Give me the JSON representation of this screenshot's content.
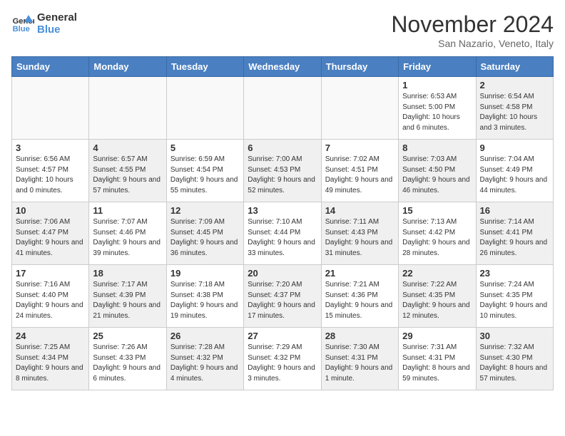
{
  "logo": {
    "line1": "General",
    "line2": "Blue"
  },
  "title": "November 2024",
  "location": "San Nazario, Veneto, Italy",
  "days_of_week": [
    "Sunday",
    "Monday",
    "Tuesday",
    "Wednesday",
    "Thursday",
    "Friday",
    "Saturday"
  ],
  "weeks": [
    [
      {
        "day": "",
        "info": "",
        "empty": true
      },
      {
        "day": "",
        "info": "",
        "empty": true
      },
      {
        "day": "",
        "info": "",
        "empty": true
      },
      {
        "day": "",
        "info": "",
        "empty": true
      },
      {
        "day": "",
        "info": "",
        "empty": true
      },
      {
        "day": "1",
        "info": "Sunrise: 6:53 AM\nSunset: 5:00 PM\nDaylight: 10 hours and 6 minutes."
      },
      {
        "day": "2",
        "info": "Sunrise: 6:54 AM\nSunset: 4:58 PM\nDaylight: 10 hours and 3 minutes.",
        "shaded": true
      }
    ],
    [
      {
        "day": "3",
        "info": "Sunrise: 6:56 AM\nSunset: 4:57 PM\nDaylight: 10 hours and 0 minutes."
      },
      {
        "day": "4",
        "info": "Sunrise: 6:57 AM\nSunset: 4:55 PM\nDaylight: 9 hours and 57 minutes.",
        "shaded": true
      },
      {
        "day": "5",
        "info": "Sunrise: 6:59 AM\nSunset: 4:54 PM\nDaylight: 9 hours and 55 minutes."
      },
      {
        "day": "6",
        "info": "Sunrise: 7:00 AM\nSunset: 4:53 PM\nDaylight: 9 hours and 52 minutes.",
        "shaded": true
      },
      {
        "day": "7",
        "info": "Sunrise: 7:02 AM\nSunset: 4:51 PM\nDaylight: 9 hours and 49 minutes."
      },
      {
        "day": "8",
        "info": "Sunrise: 7:03 AM\nSunset: 4:50 PM\nDaylight: 9 hours and 46 minutes.",
        "shaded": true
      },
      {
        "day": "9",
        "info": "Sunrise: 7:04 AM\nSunset: 4:49 PM\nDaylight: 9 hours and 44 minutes."
      }
    ],
    [
      {
        "day": "10",
        "info": "Sunrise: 7:06 AM\nSunset: 4:47 PM\nDaylight: 9 hours and 41 minutes.",
        "shaded": true
      },
      {
        "day": "11",
        "info": "Sunrise: 7:07 AM\nSunset: 4:46 PM\nDaylight: 9 hours and 39 minutes."
      },
      {
        "day": "12",
        "info": "Sunrise: 7:09 AM\nSunset: 4:45 PM\nDaylight: 9 hours and 36 minutes.",
        "shaded": true
      },
      {
        "day": "13",
        "info": "Sunrise: 7:10 AM\nSunset: 4:44 PM\nDaylight: 9 hours and 33 minutes."
      },
      {
        "day": "14",
        "info": "Sunrise: 7:11 AM\nSunset: 4:43 PM\nDaylight: 9 hours and 31 minutes.",
        "shaded": true
      },
      {
        "day": "15",
        "info": "Sunrise: 7:13 AM\nSunset: 4:42 PM\nDaylight: 9 hours and 28 minutes."
      },
      {
        "day": "16",
        "info": "Sunrise: 7:14 AM\nSunset: 4:41 PM\nDaylight: 9 hours and 26 minutes.",
        "shaded": true
      }
    ],
    [
      {
        "day": "17",
        "info": "Sunrise: 7:16 AM\nSunset: 4:40 PM\nDaylight: 9 hours and 24 minutes."
      },
      {
        "day": "18",
        "info": "Sunrise: 7:17 AM\nSunset: 4:39 PM\nDaylight: 9 hours and 21 minutes.",
        "shaded": true
      },
      {
        "day": "19",
        "info": "Sunrise: 7:18 AM\nSunset: 4:38 PM\nDaylight: 9 hours and 19 minutes."
      },
      {
        "day": "20",
        "info": "Sunrise: 7:20 AM\nSunset: 4:37 PM\nDaylight: 9 hours and 17 minutes.",
        "shaded": true
      },
      {
        "day": "21",
        "info": "Sunrise: 7:21 AM\nSunset: 4:36 PM\nDaylight: 9 hours and 15 minutes."
      },
      {
        "day": "22",
        "info": "Sunrise: 7:22 AM\nSunset: 4:35 PM\nDaylight: 9 hours and 12 minutes.",
        "shaded": true
      },
      {
        "day": "23",
        "info": "Sunrise: 7:24 AM\nSunset: 4:35 PM\nDaylight: 9 hours and 10 minutes."
      }
    ],
    [
      {
        "day": "24",
        "info": "Sunrise: 7:25 AM\nSunset: 4:34 PM\nDaylight: 9 hours and 8 minutes.",
        "shaded": true
      },
      {
        "day": "25",
        "info": "Sunrise: 7:26 AM\nSunset: 4:33 PM\nDaylight: 9 hours and 6 minutes."
      },
      {
        "day": "26",
        "info": "Sunrise: 7:28 AM\nSunset: 4:32 PM\nDaylight: 9 hours and 4 minutes.",
        "shaded": true
      },
      {
        "day": "27",
        "info": "Sunrise: 7:29 AM\nSunset: 4:32 PM\nDaylight: 9 hours and 3 minutes."
      },
      {
        "day": "28",
        "info": "Sunrise: 7:30 AM\nSunset: 4:31 PM\nDaylight: 9 hours and 1 minute.",
        "shaded": true
      },
      {
        "day": "29",
        "info": "Sunrise: 7:31 AM\nSunset: 4:31 PM\nDaylight: 8 hours and 59 minutes."
      },
      {
        "day": "30",
        "info": "Sunrise: 7:32 AM\nSunset: 4:30 PM\nDaylight: 8 hours and 57 minutes.",
        "shaded": true
      }
    ]
  ]
}
